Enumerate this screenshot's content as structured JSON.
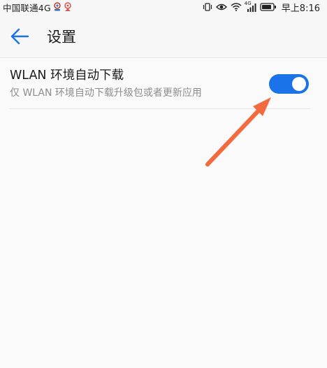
{
  "status_bar": {
    "carrier": "中国联通4G",
    "time": "早上8:16",
    "network_label": "4G",
    "icons": [
      "weibo-notification-icon",
      "app-notification-icon",
      "vibrate-icon",
      "eye-icon",
      "wifi-icon",
      "signal-icon",
      "battery-icon"
    ]
  },
  "header": {
    "back_icon": "arrow-left-icon",
    "title": "设置"
  },
  "settings": {
    "items": [
      {
        "title": "WLAN 环境自动下载",
        "description": "仅 WLAN 环境自动下载升级包或者更新应用",
        "toggle_on": true
      }
    ]
  },
  "colors": {
    "accent": "#1a73e8",
    "annotation_arrow": "#f26a3d",
    "title_text": "#1b1b1b",
    "secondary_text": "#8d8d8d"
  }
}
